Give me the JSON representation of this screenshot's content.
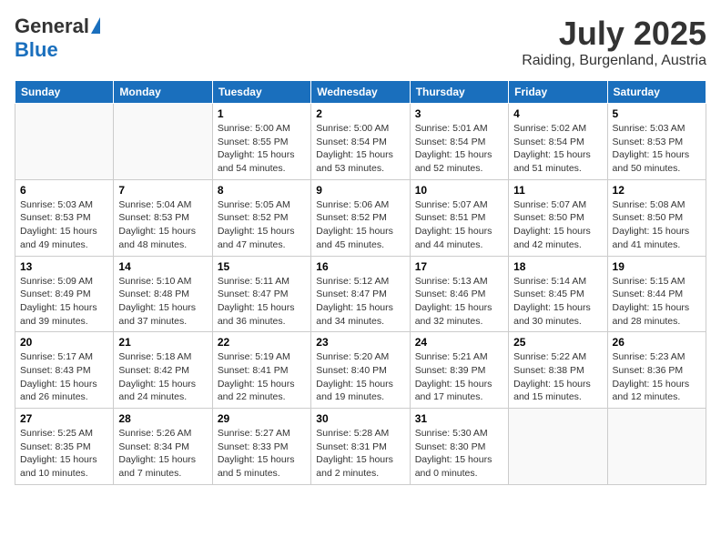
{
  "header": {
    "logo_general": "General",
    "logo_blue": "Blue",
    "title": "July 2025",
    "location": "Raiding, Burgenland, Austria"
  },
  "days_of_week": [
    "Sunday",
    "Monday",
    "Tuesday",
    "Wednesday",
    "Thursday",
    "Friday",
    "Saturday"
  ],
  "weeks": [
    [
      {
        "day": "",
        "info": ""
      },
      {
        "day": "",
        "info": ""
      },
      {
        "day": "1",
        "sunrise": "5:00 AM",
        "sunset": "8:55 PM",
        "daylight": "15 hours and 54 minutes."
      },
      {
        "day": "2",
        "sunrise": "5:00 AM",
        "sunset": "8:54 PM",
        "daylight": "15 hours and 53 minutes."
      },
      {
        "day": "3",
        "sunrise": "5:01 AM",
        "sunset": "8:54 PM",
        "daylight": "15 hours and 52 minutes."
      },
      {
        "day": "4",
        "sunrise": "5:02 AM",
        "sunset": "8:54 PM",
        "daylight": "15 hours and 51 minutes."
      },
      {
        "day": "5",
        "sunrise": "5:03 AM",
        "sunset": "8:53 PM",
        "daylight": "15 hours and 50 minutes."
      }
    ],
    [
      {
        "day": "6",
        "sunrise": "5:03 AM",
        "sunset": "8:53 PM",
        "daylight": "15 hours and 49 minutes."
      },
      {
        "day": "7",
        "sunrise": "5:04 AM",
        "sunset": "8:53 PM",
        "daylight": "15 hours and 48 minutes."
      },
      {
        "day": "8",
        "sunrise": "5:05 AM",
        "sunset": "8:52 PM",
        "daylight": "15 hours and 47 minutes."
      },
      {
        "day": "9",
        "sunrise": "5:06 AM",
        "sunset": "8:52 PM",
        "daylight": "15 hours and 45 minutes."
      },
      {
        "day": "10",
        "sunrise": "5:07 AM",
        "sunset": "8:51 PM",
        "daylight": "15 hours and 44 minutes."
      },
      {
        "day": "11",
        "sunrise": "5:07 AM",
        "sunset": "8:50 PM",
        "daylight": "15 hours and 42 minutes."
      },
      {
        "day": "12",
        "sunrise": "5:08 AM",
        "sunset": "8:50 PM",
        "daylight": "15 hours and 41 minutes."
      }
    ],
    [
      {
        "day": "13",
        "sunrise": "5:09 AM",
        "sunset": "8:49 PM",
        "daylight": "15 hours and 39 minutes."
      },
      {
        "day": "14",
        "sunrise": "5:10 AM",
        "sunset": "8:48 PM",
        "daylight": "15 hours and 37 minutes."
      },
      {
        "day": "15",
        "sunrise": "5:11 AM",
        "sunset": "8:47 PM",
        "daylight": "15 hours and 36 minutes."
      },
      {
        "day": "16",
        "sunrise": "5:12 AM",
        "sunset": "8:47 PM",
        "daylight": "15 hours and 34 minutes."
      },
      {
        "day": "17",
        "sunrise": "5:13 AM",
        "sunset": "8:46 PM",
        "daylight": "15 hours and 32 minutes."
      },
      {
        "day": "18",
        "sunrise": "5:14 AM",
        "sunset": "8:45 PM",
        "daylight": "15 hours and 30 minutes."
      },
      {
        "day": "19",
        "sunrise": "5:15 AM",
        "sunset": "8:44 PM",
        "daylight": "15 hours and 28 minutes."
      }
    ],
    [
      {
        "day": "20",
        "sunrise": "5:17 AM",
        "sunset": "8:43 PM",
        "daylight": "15 hours and 26 minutes."
      },
      {
        "day": "21",
        "sunrise": "5:18 AM",
        "sunset": "8:42 PM",
        "daylight": "15 hours and 24 minutes."
      },
      {
        "day": "22",
        "sunrise": "5:19 AM",
        "sunset": "8:41 PM",
        "daylight": "15 hours and 22 minutes."
      },
      {
        "day": "23",
        "sunrise": "5:20 AM",
        "sunset": "8:40 PM",
        "daylight": "15 hours and 19 minutes."
      },
      {
        "day": "24",
        "sunrise": "5:21 AM",
        "sunset": "8:39 PM",
        "daylight": "15 hours and 17 minutes."
      },
      {
        "day": "25",
        "sunrise": "5:22 AM",
        "sunset": "8:38 PM",
        "daylight": "15 hours and 15 minutes."
      },
      {
        "day": "26",
        "sunrise": "5:23 AM",
        "sunset": "8:36 PM",
        "daylight": "15 hours and 12 minutes."
      }
    ],
    [
      {
        "day": "27",
        "sunrise": "5:25 AM",
        "sunset": "8:35 PM",
        "daylight": "15 hours and 10 minutes."
      },
      {
        "day": "28",
        "sunrise": "5:26 AM",
        "sunset": "8:34 PM",
        "daylight": "15 hours and 7 minutes."
      },
      {
        "day": "29",
        "sunrise": "5:27 AM",
        "sunset": "8:33 PM",
        "daylight": "15 hours and 5 minutes."
      },
      {
        "day": "30",
        "sunrise": "5:28 AM",
        "sunset": "8:31 PM",
        "daylight": "15 hours and 2 minutes."
      },
      {
        "day": "31",
        "sunrise": "5:30 AM",
        "sunset": "8:30 PM",
        "daylight": "15 hours and 0 minutes."
      },
      {
        "day": "",
        "info": ""
      },
      {
        "day": "",
        "info": ""
      }
    ]
  ]
}
